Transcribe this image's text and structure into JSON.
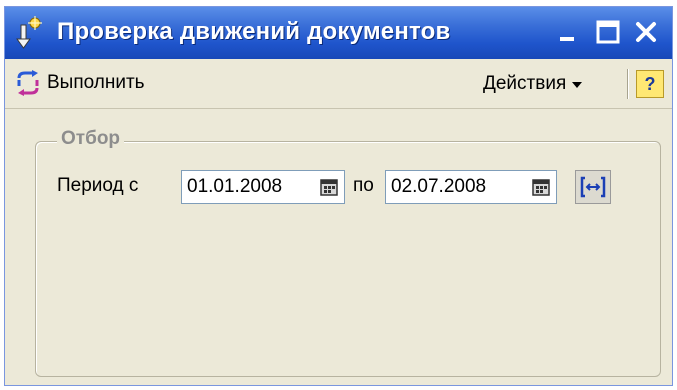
{
  "window": {
    "title": "Проверка движений документов"
  },
  "toolbar": {
    "run_label": "Выполнить",
    "actions_label": "Действия",
    "help_label": "?"
  },
  "filter": {
    "group_title": "Отбор",
    "period_from_label": "Период с",
    "date_from": "01.01.2008",
    "to_label": "по",
    "date_to": "02.07.2008"
  },
  "icons": {
    "title": "document-movements-icon",
    "run": "run-arrows-icon",
    "calendar": "calendar-icon",
    "period": "period-select-icon"
  }
}
